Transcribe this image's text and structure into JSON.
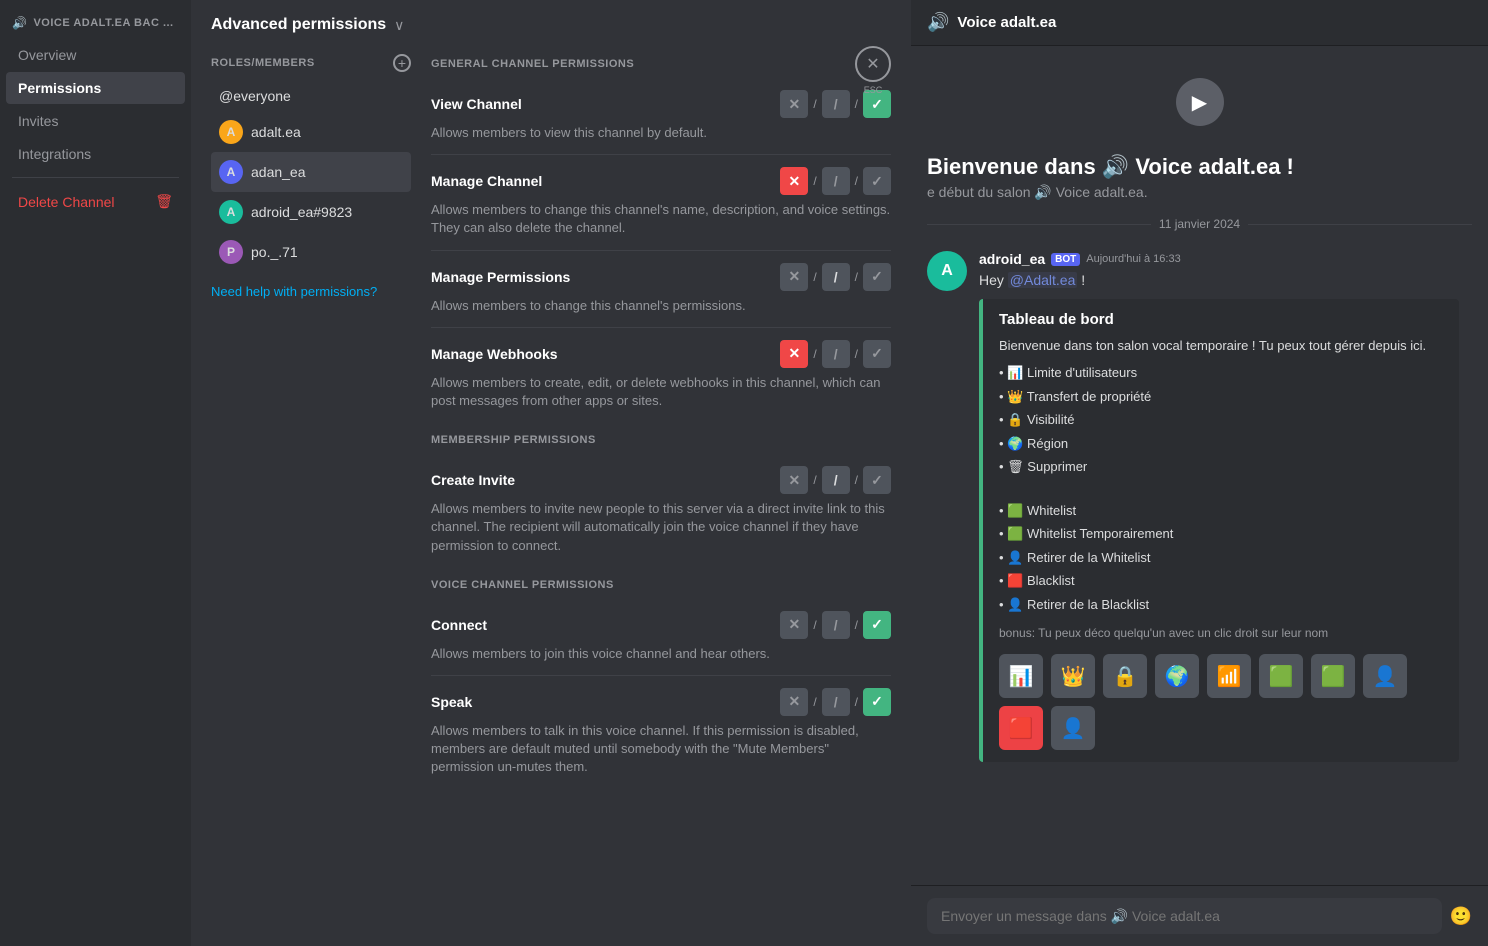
{
  "sidebar": {
    "channel_header": "VOICE ADALT.EA BAC ...",
    "nav_items": [
      {
        "id": "overview",
        "label": "Overview",
        "active": false
      },
      {
        "id": "permissions",
        "label": "Permissions",
        "active": true
      },
      {
        "id": "invites",
        "label": "Invites",
        "active": false
      },
      {
        "id": "integrations",
        "label": "Integrations",
        "active": false
      }
    ],
    "delete_label": "Delete Channel"
  },
  "advanced_permissions": {
    "title": "Advanced permissions",
    "roles_header": "ROLES/MEMBERS",
    "members": [
      {
        "id": "everyone",
        "name": "@everyone",
        "type": "everyone"
      },
      {
        "id": "adalt",
        "name": "adalt.ea",
        "type": "user",
        "color": "orange"
      },
      {
        "id": "adan",
        "name": "adan_ea",
        "type": "user",
        "color": "blue",
        "selected": true
      },
      {
        "id": "adroid",
        "name": "adroid_ea#9823",
        "type": "user",
        "color": "teal"
      },
      {
        "id": "po",
        "name": "po._.71",
        "type": "user",
        "color": "purple"
      }
    ],
    "help_link": "Need help with permissions?",
    "sections": {
      "general": {
        "title": "GENERAL CHANNEL PERMISSIONS",
        "permissions": [
          {
            "name": "View Channel",
            "desc": "Allows members to view this channel by default.",
            "state": "allow"
          },
          {
            "name": "Manage Channel",
            "desc": "Allows members to change this channel's name, description, and voice settings. They can also delete the channel.",
            "state": "deny"
          },
          {
            "name": "Manage Permissions",
            "desc": "Allows members to change this channel's permissions.",
            "state": "neutral"
          },
          {
            "name": "Manage Webhooks",
            "desc": "Allows members to create, edit, or delete webhooks in this channel, which can post messages from other apps or sites.",
            "state": "deny"
          }
        ]
      },
      "membership": {
        "title": "MEMBERSHIP PERMISSIONS",
        "permissions": [
          {
            "name": "Create Invite",
            "desc": "Allows members to invite new people to this server via a direct invite link to this channel. The recipient will automatically join the voice channel if they have permission to connect.",
            "state": "neutral"
          }
        ]
      },
      "voice": {
        "title": "VOICE CHANNEL PERMISSIONS",
        "permissions": [
          {
            "name": "Connect",
            "desc": "Allows members to join this voice channel and hear others.",
            "state": "allow"
          },
          {
            "name": "Speak",
            "desc": "Allows members to talk in this voice channel. If this permission is disabled, members are default muted until somebody with the \"Mute Members\" permission un-mutes them.",
            "state": "allow"
          }
        ]
      }
    }
  },
  "voice_channel": {
    "title": "Voice adalt.ea",
    "welcome_title": "Bienvenue dans 🔊 Voice adalt.ea !",
    "welcome_sub": "e début du salon 🔊 Voice adalt.ea.",
    "date_sep": "11 janvier 2024",
    "message": {
      "username": "adroid_ea",
      "badge": "BOT",
      "timestamp": "Aujourd'hui à 16:33",
      "text_before": "Hey ",
      "mention": "@Adalt.ea",
      "text_after": " !",
      "embed": {
        "title": "Tableau de bord",
        "intro": "Bienvenue dans ton salon vocal temporaire ! Tu peux tout gérer depuis ici.",
        "list1": [
          "📊 Limite d'utilisateurs",
          "👑 Transfert de propriété",
          "🔒 Visibilité",
          "🌍 Région",
          "🗑 Supprimer"
        ],
        "list2": [
          "🟩 Whitelist",
          "🟩 Whitelist Temporairement",
          "👤 Retirer de la Whitelist",
          "🟥 Blacklist",
          "👤 Retirer de la Blacklist"
        ],
        "bonus": "bonus: Tu peux déco quelqu'un avec un clic droit sur leur nom",
        "buttons": [
          {
            "id": "btn1",
            "icon": "📊",
            "highlighted": false
          },
          {
            "id": "btn2",
            "icon": "👑",
            "highlighted": false
          },
          {
            "id": "btn3",
            "icon": "🔒",
            "highlighted": false
          },
          {
            "id": "btn4",
            "icon": "🌍",
            "highlighted": false
          },
          {
            "id": "btn5",
            "icon": "📶",
            "highlighted": false
          },
          {
            "id": "btn6",
            "icon": "🟩",
            "highlighted": false
          },
          {
            "id": "btn7",
            "icon": "🟩",
            "highlighted": false
          },
          {
            "id": "btn8",
            "icon": "👤",
            "highlighted": false
          },
          {
            "id": "btn9",
            "icon": "🟥",
            "highlighted": true
          },
          {
            "id": "btn10",
            "icon": "👤",
            "highlighted": false
          }
        ]
      }
    },
    "input_placeholder": "Envoyer un message dans 🔊 Voice adalt.ea"
  },
  "icons": {
    "close": "✕",
    "chevron_down": "∨",
    "add": "+",
    "trash": "🗑",
    "deny": "✕",
    "neutral": "/",
    "allow": "✓",
    "volume": "🔊"
  }
}
